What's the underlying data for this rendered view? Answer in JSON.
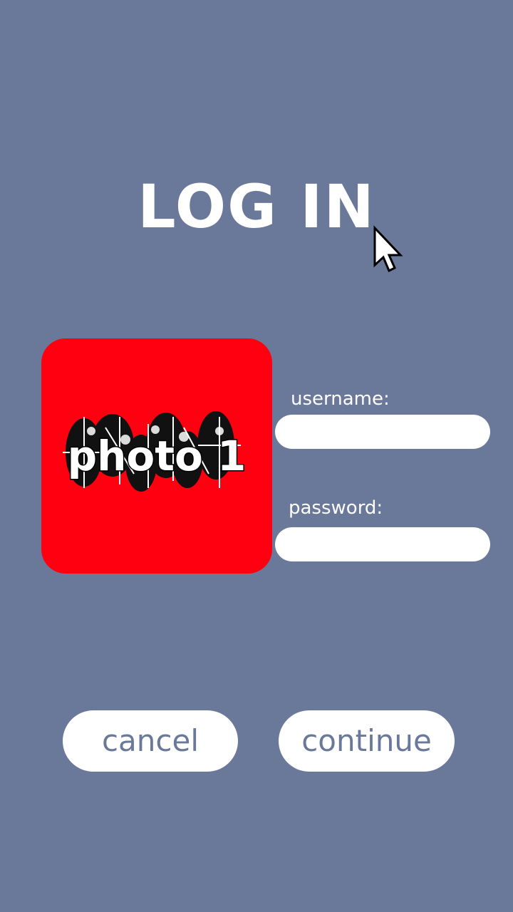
{
  "title": "LOG IN",
  "photo": {
    "label": "photo 1",
    "background_color": "#ff0010"
  },
  "form": {
    "username_label": "username:",
    "username_value": "",
    "password_label": "password:",
    "password_value": ""
  },
  "buttons": {
    "cancel_label": "cancel",
    "continue_label": "continue"
  },
  "colors": {
    "background": "#6a7899",
    "text": "#ffffff",
    "button_text": "#6a7899"
  },
  "icons": {
    "cursor": "mouse-pointer-icon"
  }
}
